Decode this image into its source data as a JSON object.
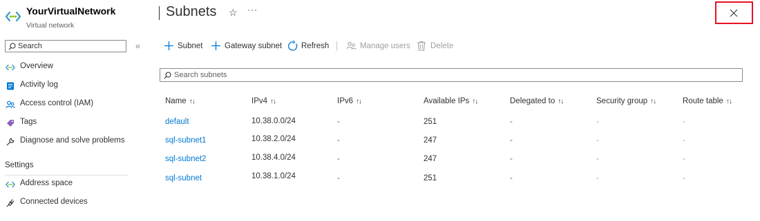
{
  "resource": {
    "name": "YourVirtualNetwork",
    "type": "Virtual network"
  },
  "menu": {
    "search_placeholder": "Search",
    "collapse_glyph": "«",
    "items": [
      {
        "label": "Overview",
        "icon": "vnet-icon"
      },
      {
        "label": "Activity log",
        "icon": "activity-log-icon"
      },
      {
        "label": "Access control (IAM)",
        "icon": "iam-people-icon"
      },
      {
        "label": "Tags",
        "icon": "tag-icon"
      },
      {
        "label": "Diagnose and solve problems",
        "icon": "wrench-icon"
      }
    ],
    "settings_header": "Settings",
    "settings_items": [
      {
        "label": "Address space",
        "icon": "vnet-icon"
      },
      {
        "label": "Connected devices",
        "icon": "plug-icon"
      }
    ]
  },
  "header": {
    "title": "Subnets",
    "favorite_glyph": "☆",
    "more_glyph": "···"
  },
  "toolbar": {
    "add_subnet": "Subnet",
    "add_gateway_subnet": "Gateway subnet",
    "refresh": "Refresh",
    "manage_users": "Manage users",
    "delete": "Delete"
  },
  "subnet_search": {
    "placeholder": "Search subnets"
  },
  "grid": {
    "sort_glyph": "↑↓",
    "columns": [
      "Name",
      "IPv4",
      "IPv6",
      "Available IPs",
      "Delegated to",
      "Security group",
      "Route table"
    ],
    "rows": [
      {
        "name": "default",
        "ipv4": "10.38.0.0/24",
        "ipv6": "-",
        "available_ips": "251",
        "delegated_to": "-",
        "security_group": "-",
        "route_table": "-"
      },
      {
        "name": "sql-subnet1",
        "ipv4": "10.38.2.0/24",
        "ipv6": "-",
        "available_ips": "247",
        "delegated_to": "-",
        "security_group": "-",
        "route_table": "-"
      },
      {
        "name": "sql-subnet2",
        "ipv4": "10.38.4.0/24",
        "ipv6": "-",
        "available_ips": "247",
        "delegated_to": "-",
        "security_group": "-",
        "route_table": "-"
      },
      {
        "name": "sql-subnet",
        "ipv4": "10.38.1.0/24",
        "ipv6": "-",
        "available_ips": "251",
        "delegated_to": "-",
        "security_group": "-",
        "route_table": "-"
      }
    ]
  },
  "colors": {
    "accent": "#0078d4",
    "close_highlight": "#e81123",
    "tag": "#8764b8",
    "vnet_green": "#5ea0ef"
  }
}
